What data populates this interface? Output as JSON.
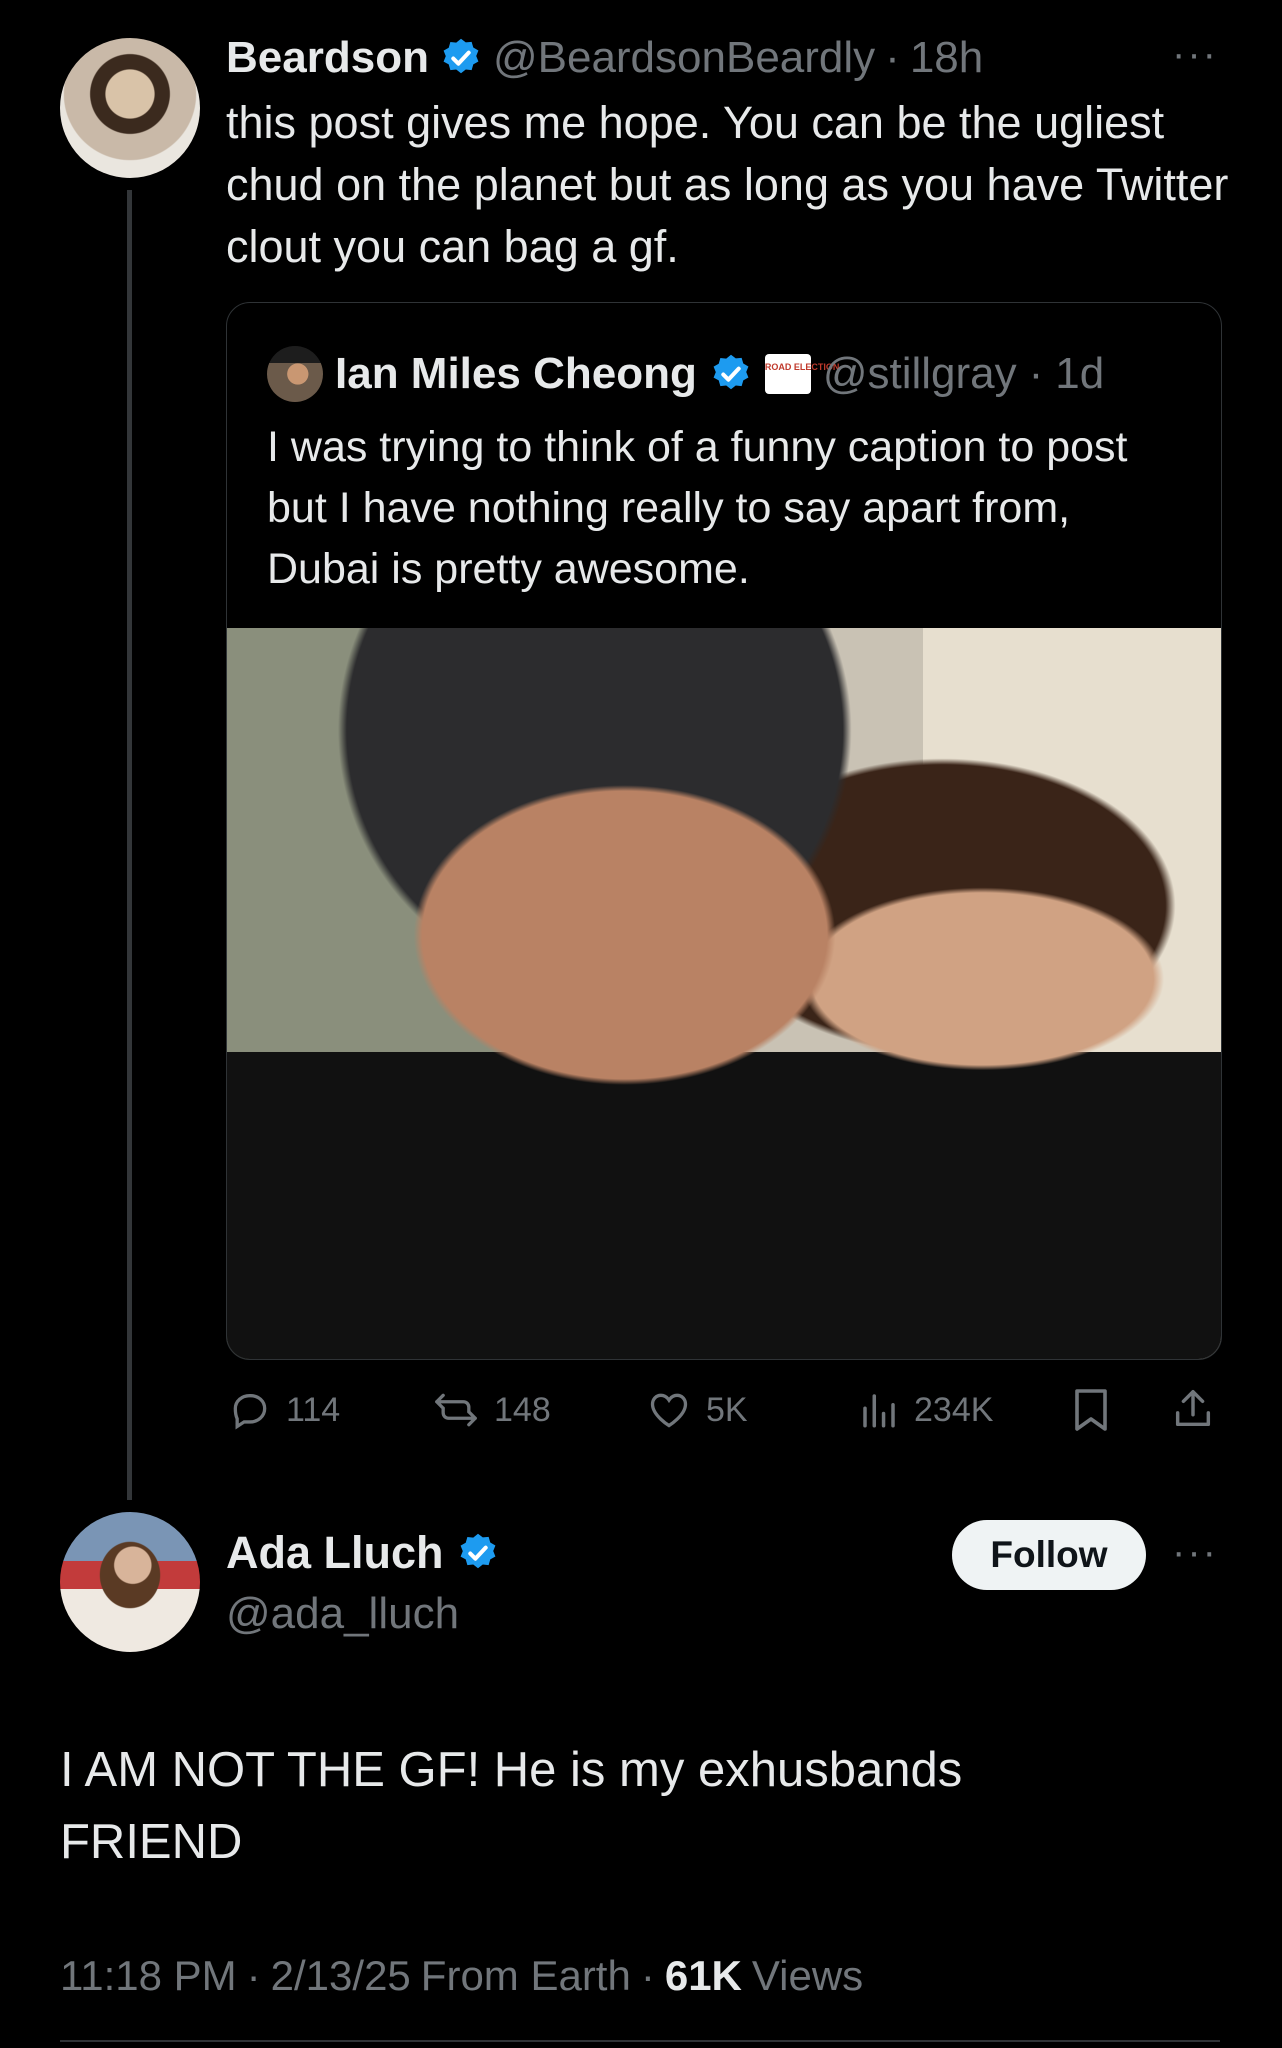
{
  "parent_tweet": {
    "display_name": "Beardson",
    "handle": "@BeardsonBeardly",
    "separator": "·",
    "time": "18h",
    "text": "this post gives me hope. You can be the ugliest chud on the planet but as long as you have Twitter clout you can bag a gf.",
    "more_label": "···"
  },
  "quoted_tweet": {
    "display_name": "Ian Miles Cheong",
    "affiliate_badge_text": "ROAD ELECTION",
    "handle": "@stillgray",
    "separator": "·",
    "time": "1d",
    "text": "I was trying to think of a funny caption to post but I have nothing really to say apart from, Dubai is pretty awesome."
  },
  "parent_actions": {
    "replies": "114",
    "reposts": "148",
    "likes": "5K",
    "views": "234K"
  },
  "main_tweet": {
    "display_name": "Ada Lluch",
    "handle": "@ada_lluch",
    "follow_label": "Follow",
    "more_label": "···",
    "text": "I AM NOT THE GF! He is my exhusbands FRIEND",
    "meta": {
      "time": "11:18 PM",
      "sep1": "·",
      "date": "2/13/25",
      "source": "From Earth",
      "sep2": "·",
      "views_count": "61K",
      "views_label": "Views"
    }
  },
  "colors": {
    "background": "#000000",
    "text_primary": "#e7e9ea",
    "text_secondary": "#71767b",
    "verified_blue": "#1d9bf0",
    "border": "#2f3336"
  },
  "icons": [
    "reply-icon",
    "repost-icon",
    "like-icon",
    "views-icon",
    "bookmark-icon",
    "share-icon",
    "verified-badge-icon",
    "more-icon"
  ]
}
